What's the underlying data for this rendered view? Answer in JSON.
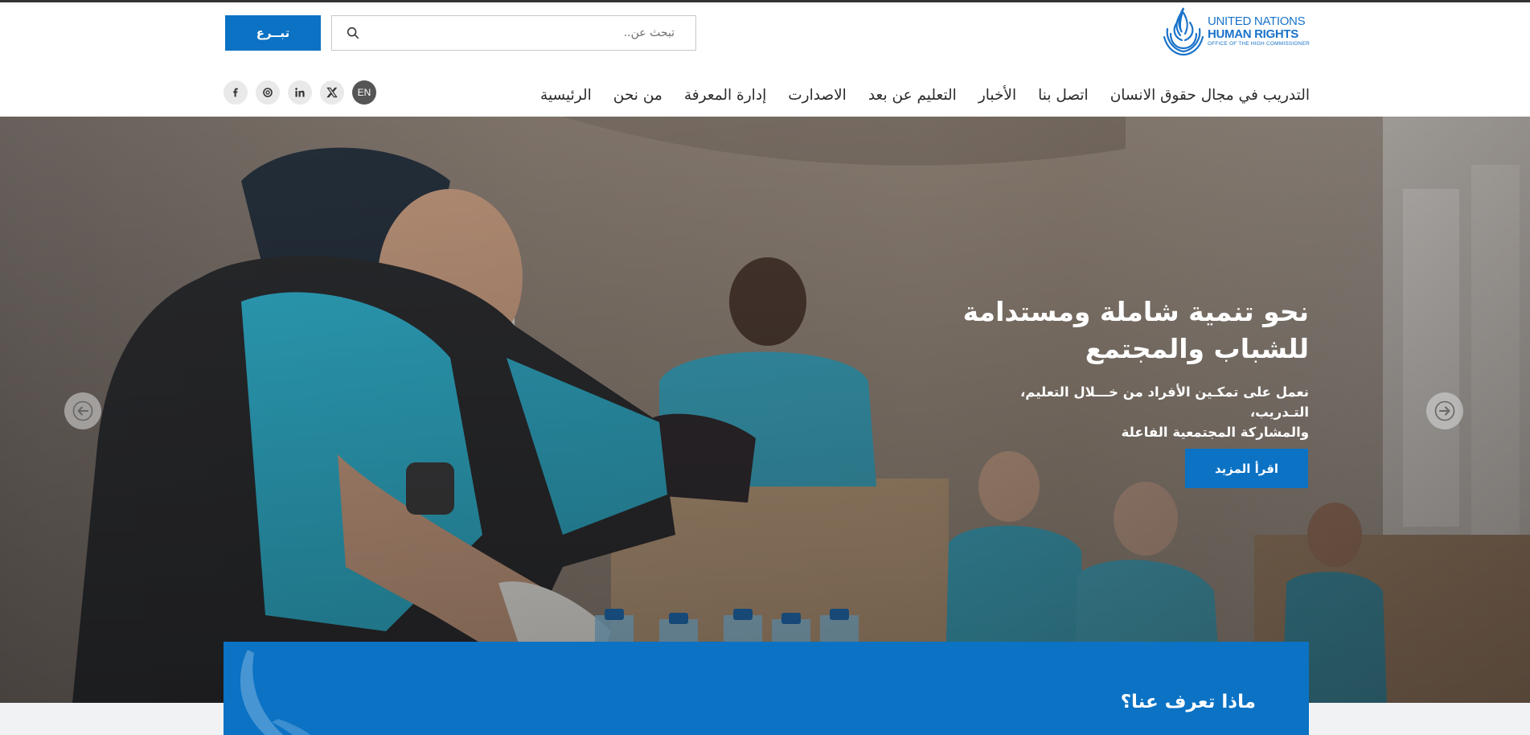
{
  "header": {
    "logo": {
      "line1": "UNITED NATIONS",
      "line2": "HUMAN RIGHTS",
      "line3": "OFFICE OF THE HIGH COMMISSIONER"
    },
    "search": {
      "placeholder": "تبحث عن.."
    },
    "donate_label": "تبــرع"
  },
  "nav": {
    "items": [
      {
        "label": "الرئيسية"
      },
      {
        "label": "من نحن"
      },
      {
        "label": "إدارة المعرفة"
      },
      {
        "label": "الاصدارت"
      },
      {
        "label": "التعليم عن بعد"
      },
      {
        "label": "الأخبار"
      },
      {
        "label": "اتصل بنا"
      },
      {
        "label": "التدريب في مجال حقوق الانسان"
      }
    ]
  },
  "social": {
    "language_label": "EN",
    "icons": [
      "x-icon",
      "linkedin-icon",
      "instagram-icon",
      "facebook-icon"
    ]
  },
  "hero": {
    "title_line1": "نحو تنمية شاملة ومستدامة",
    "title_line2": "للشباب والمجتمع",
    "subtitle_line1": "نعمل على تمكـين الأفراد من خـــلال التعليم، التـدريب،",
    "subtitle_line2": "والمشاركة المجتمعية الفاعلة",
    "button_label": "اقرأ المزيد"
  },
  "about": {
    "title": "ماذا تعرف عنا؟"
  },
  "colors": {
    "brand_blue": "#0b72c4",
    "logo_blue": "#1a73c9",
    "nav_text": "#2a2a2a"
  }
}
